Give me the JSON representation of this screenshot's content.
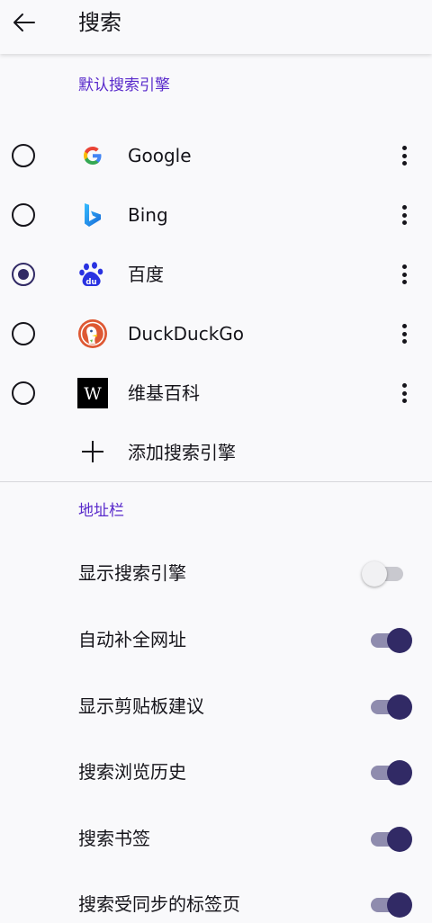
{
  "header": {
    "title": "搜索",
    "back_icon": "arrow-left-icon"
  },
  "default_engine_section": {
    "header": "默认搜索引擎",
    "engines": [
      {
        "label": "Google",
        "selected": false,
        "icon": "google-logo-icon"
      },
      {
        "label": "Bing",
        "selected": false,
        "icon": "bing-logo-icon"
      },
      {
        "label": "百度",
        "selected": true,
        "icon": "baidu-logo-icon"
      },
      {
        "label": "DuckDuckGo",
        "selected": false,
        "icon": "duckduckgo-logo-icon"
      },
      {
        "label": "维基百科",
        "selected": false,
        "icon": "wikipedia-logo-icon"
      }
    ],
    "add_label": "添加搜索引擎"
  },
  "address_bar_section": {
    "header": "地址栏",
    "toggles": [
      {
        "label": "显示搜索引擎",
        "on": false
      },
      {
        "label": "自动补全网址",
        "on": true
      },
      {
        "label": "显示剪贴板建议",
        "on": true
      },
      {
        "label": "搜索浏览历史",
        "on": true
      },
      {
        "label": "搜索书签",
        "on": true
      },
      {
        "label": "搜索受同步的标签页",
        "on": true
      }
    ]
  },
  "colors": {
    "accent": "#592acb",
    "toggle_on": "#312a65",
    "background": "#f9f9fb"
  }
}
